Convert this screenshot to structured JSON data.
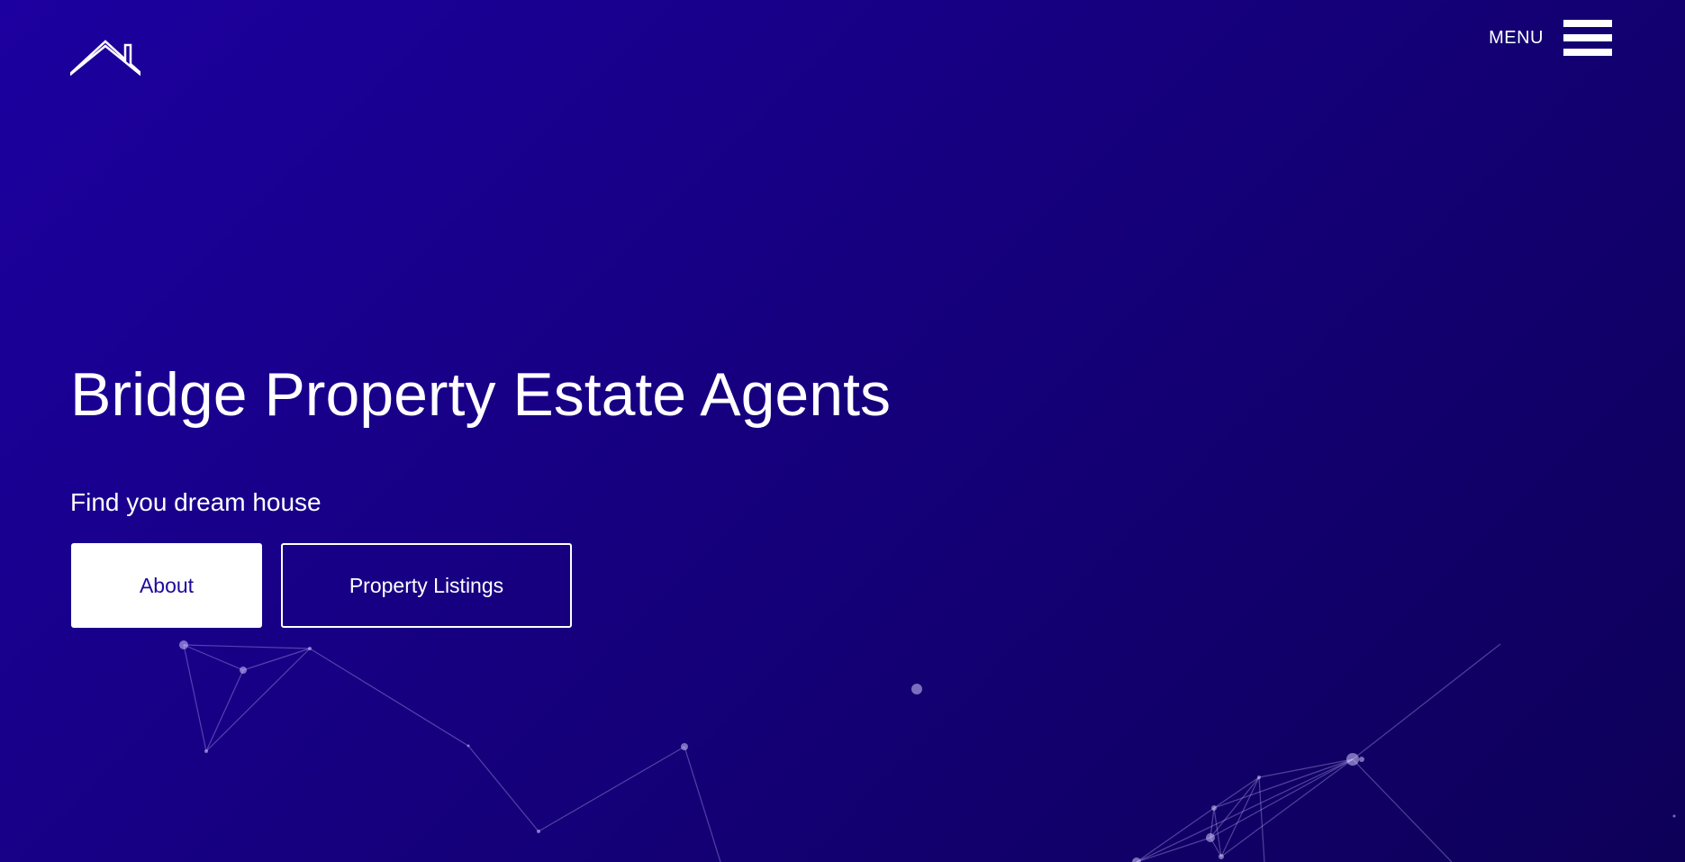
{
  "header": {
    "logo_icon": "house-roof-icon",
    "menu_label": "MENU",
    "menu_icon": "hamburger-icon"
  },
  "hero": {
    "title": "Bridge Property Estate Agents",
    "subtitle": "Find you dream house",
    "primary_button": "About",
    "secondary_button": "Property Listings"
  },
  "colors": {
    "background_start": "#1d00a0",
    "background_end": "#0d0058",
    "text": "#ffffff",
    "primary_button_text": "#1d0a9c"
  }
}
